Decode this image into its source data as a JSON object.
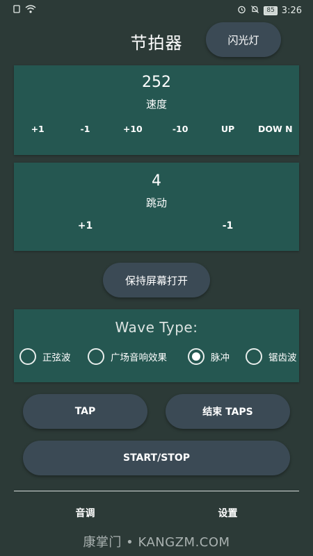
{
  "status_bar": {
    "battery": "85",
    "time": "3:26"
  },
  "header": {
    "title": "节拍器",
    "flash_label": "闪光灯"
  },
  "tempo": {
    "value": "252",
    "label": "速度",
    "buttons": [
      "+1",
      "-1",
      "+10",
      "-10",
      "UP",
      "DOW N"
    ]
  },
  "beats": {
    "value": "4",
    "label": "跳动",
    "buttons": [
      "+1",
      "-1"
    ]
  },
  "keep_screen_label": "保持屏幕打开",
  "wave": {
    "title": "Wave Type:",
    "options": [
      {
        "label": "正弦波",
        "checked": false
      },
      {
        "label": "广场音响效果",
        "checked": false
      },
      {
        "label": "脉冲",
        "checked": true
      },
      {
        "label": "锯齿波",
        "checked": false
      }
    ]
  },
  "actions": {
    "tap": "TAP",
    "end_taps": "结束 TAPS",
    "start_stop": "START/STOP"
  },
  "bottom_nav": {
    "pitch": "音调",
    "settings": "设置"
  },
  "watermark": "康掌门 • KANGZM.COM",
  "colors": {
    "background": "#2c3a37",
    "panel": "#255751",
    "button": "#3b4a55",
    "text": "#ffffff"
  }
}
